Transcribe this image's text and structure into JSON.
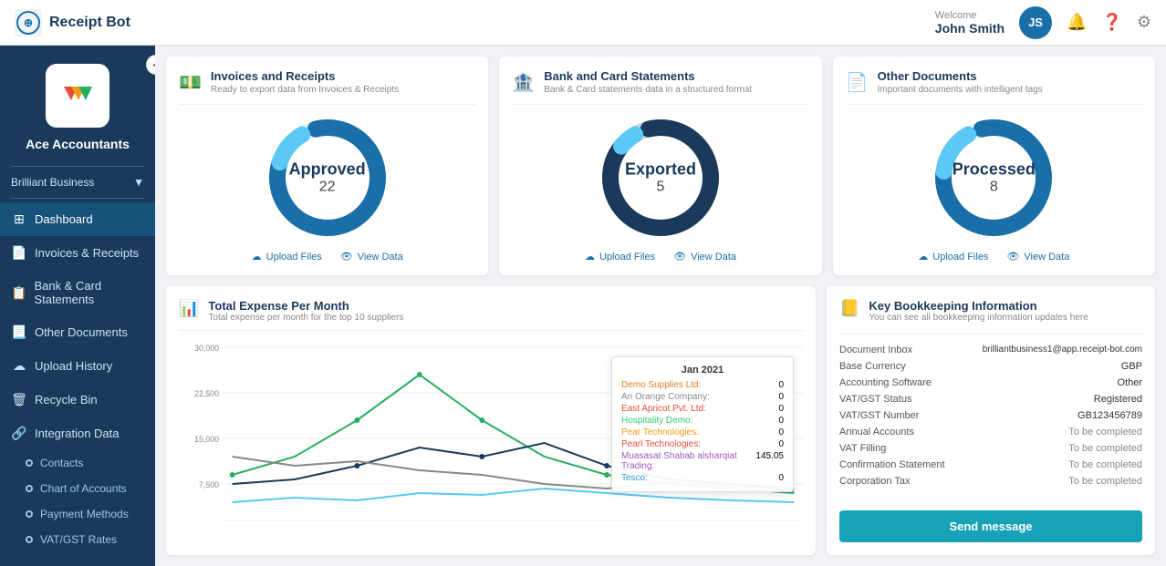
{
  "topnav": {
    "brand": "Receipt Bot",
    "welcome": "Welcome",
    "user": "John Smith",
    "initials": "JS"
  },
  "sidebar": {
    "company": "Ace Accountants",
    "org": "Brilliant Business",
    "items": [
      {
        "label": "Dashboard",
        "icon": "⊞",
        "active": true
      },
      {
        "label": "Invoices & Receipts",
        "icon": "📄"
      },
      {
        "label": "Bank & Card Statements",
        "icon": "📋"
      },
      {
        "label": "Other Documents",
        "icon": "📃"
      },
      {
        "label": "Upload History",
        "icon": "☁"
      },
      {
        "label": "Recycle Bin",
        "icon": "🗑"
      },
      {
        "label": "Integration Data",
        "icon": "🔗"
      }
    ],
    "subitems": [
      {
        "label": "Contacts"
      },
      {
        "label": "Chart of Accounts"
      },
      {
        "label": "Payment Methods"
      },
      {
        "label": "VAT/GST Rates"
      }
    ]
  },
  "cards": [
    {
      "title": "Invoices and Receipts",
      "subtitle": "Ready to export data from Invoices & Receipts",
      "status": "Approved",
      "count": 22,
      "upload": "Upload Files",
      "view": "View Data"
    },
    {
      "title": "Bank and Card Statements",
      "subtitle": "Bank & Card statements data in a structured format",
      "status": "Exported",
      "count": 5,
      "upload": "Upload Files",
      "view": "View Data"
    },
    {
      "title": "Other Documents",
      "subtitle": "Important documents with intelligent tags",
      "status": "Processed",
      "count": 8,
      "upload": "Upload Files",
      "view": "View Data"
    }
  ],
  "chart": {
    "title": "Total Expense Per Month",
    "subtitle": "Total expense per month for the top 10 suppliers",
    "yLabels": [
      "30,000",
      "22,500",
      "15,000",
      "7,500",
      ""
    ],
    "tooltip": {
      "title": "Jan 2021",
      "rows": [
        {
          "label": "Demo Supplies Ltd:",
          "value": "0",
          "color": "#e67e22"
        },
        {
          "label": "An Orange Company:",
          "value": "0",
          "color": "#888"
        },
        {
          "label": "East Apricot Pvt. Ltd:",
          "value": "0",
          "color": "#e74c3c"
        },
        {
          "label": "Hospitality Demo:",
          "value": "0",
          "color": "#2ecc71"
        },
        {
          "label": "Pear Technologies:",
          "value": "0",
          "color": "#f39c12"
        },
        {
          "label": "Pearl Technologies:",
          "value": "0",
          "color": "#e74c3c"
        },
        {
          "label": "Muasasat Shabab alsharqiat Trading:",
          "value": "145.05",
          "color": "#9b59b6"
        },
        {
          "label": "Tesco:",
          "value": "0",
          "color": "#3498db"
        }
      ]
    }
  },
  "bookkeeping": {
    "title": "Key Bookkeeping Information",
    "subtitle": "You can see all bookkeeping information updates here",
    "rows": [
      {
        "label": "Document Inbox",
        "value": "brilliantbusiness1@app.receipt-bot.com"
      },
      {
        "label": "Base Currency",
        "value": "GBP"
      },
      {
        "label": "Accounting Software",
        "value": "Other"
      },
      {
        "label": "VAT/GST Status",
        "value": "Registered"
      },
      {
        "label": "VAT/GST Number",
        "value": "GB123456789"
      },
      {
        "label": "Annual Accounts",
        "value": "To be completed",
        "pending": true
      },
      {
        "label": "VAT Filling",
        "value": "To be completed",
        "pending": true
      },
      {
        "label": "Confirmation Statement",
        "value": "To be completed",
        "pending": true
      },
      {
        "label": "Corporation Tax",
        "value": "To be completed",
        "pending": true
      }
    ],
    "sendBtn": "Send message"
  }
}
